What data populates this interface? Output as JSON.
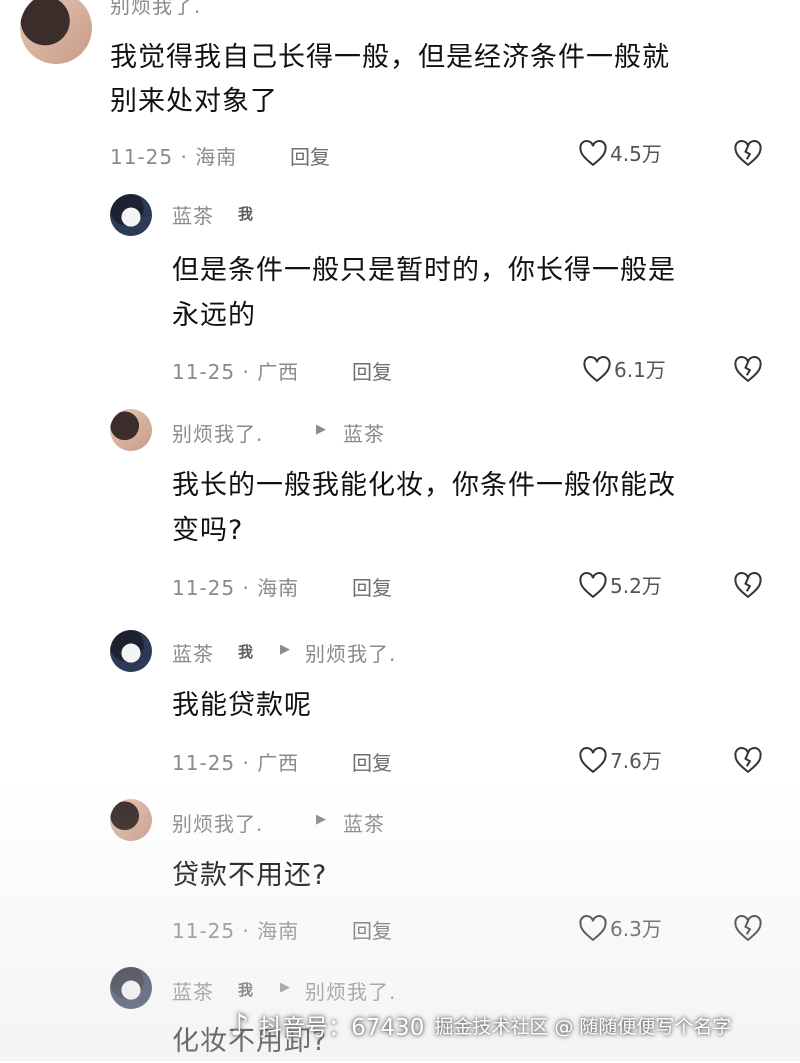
{
  "comments": [
    {
      "user": "别烦我了.",
      "text_lines": [
        "我觉得我自己长得一般，但是经济条件一般就",
        "别来处对象了"
      ],
      "date_loc": "11-25 · 海南",
      "reply": "回复",
      "likes": "4.5万"
    },
    {
      "user": "蓝茶",
      "me_tag": "我",
      "text_lines": [
        "但是条件一般只是暂时的，你长得一般是",
        "永远的"
      ],
      "date_loc": "11-25 · 广西",
      "reply": "回复",
      "likes": "6.1万"
    },
    {
      "user": "别烦我了.",
      "reply_to": "蓝茶",
      "text_lines": [
        "我长的一般我能化妆，你条件一般你能改",
        "变吗?"
      ],
      "date_loc": "11-25 · 海南",
      "reply": "回复",
      "likes": "5.2万"
    },
    {
      "user": "蓝茶",
      "me_tag": "我",
      "reply_to": "别烦我了.",
      "text_lines": [
        "我能贷款呢"
      ],
      "date_loc": "11-25 · 广西",
      "reply": "回复",
      "likes": "7.6万"
    },
    {
      "user": "别烦我了.",
      "reply_to": "蓝茶",
      "text_lines": [
        "贷款不用还?"
      ],
      "date_loc": "11-25 · 海南",
      "reply": "回复",
      "likes": "6.3万"
    },
    {
      "user": "蓝茶",
      "me_tag": "我",
      "reply_to": "别烦我了.",
      "text_lines": [
        "化妆不用卸?"
      ]
    }
  ],
  "watermark": {
    "text": "抖音号：67430",
    "text2": "掘金技术社区 @ 随随便便写个名字"
  }
}
